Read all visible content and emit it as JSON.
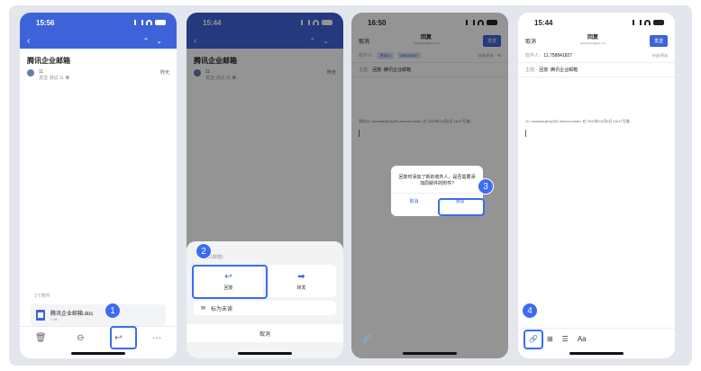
{
  "screens": [
    {
      "time": "15:56",
      "mail": {
        "subject": "腾讯企业邮箱",
        "sender_name": "11",
        "sender_detail": "发送 测试 11 ◉",
        "date": "昨天",
        "attachment_count": "1个附件",
        "attachment_name": "腾讯企业邮箱.doc",
        "attachment_size": "1.9K"
      },
      "toolbar_icons": [
        "delete-icon",
        "forward-circle-icon",
        "reply-icon",
        "more-icon"
      ],
      "step": "1"
    },
    {
      "time": "15:44",
      "mail": {
        "subject": "腾讯企业邮箱",
        "sender_name": "11",
        "sender_detail": "发送 测试 11 ◉",
        "date": "昨天"
      },
      "sheet": {
        "header": "(11邮箱)",
        "reply": "回复",
        "forward": "转发",
        "mark_unread": "标为未读",
        "cancel": "取消"
      },
      "step": "2"
    },
    {
      "time": "16:50",
      "compose": {
        "cancel": "取消",
        "title": "回复",
        "account": "11sadsh123@qq.com",
        "send": "发送",
        "to_label": "收件人:",
        "chip1": "测试11",
        "chip2": "758841827",
        "cc_label": "抄送/密送",
        "subject_label": "主题:",
        "subject_value": "回复: 腾讯企业邮箱",
        "quote": "测试11 <wushan@xiy321.wecom.work> 在 2023年10月6日 16:47写道:"
      },
      "dialog": {
        "message": "回复时添加了新的收件人，是否需要添加原邮件的附件?",
        "cancel": "取消",
        "add": "添加"
      },
      "step": "3"
    },
    {
      "time": "15:44",
      "compose": {
        "cancel": "取消",
        "title": "回复",
        "account": "11sadsh123@qq.com",
        "send": "发送",
        "to_label": "收件人:",
        "to_value": "11,758841827",
        "cc_label": "抄送/密送",
        "subject_label": "主题:",
        "subject_value": "回复: 腾讯企业邮箱",
        "quote": "11 <wushan@xiy321.wecom.work> 在 2023年10月6日 16:47写道:"
      },
      "format_label": "Aa",
      "step": "4"
    }
  ],
  "colors": {
    "accent": "#3e63d9",
    "highlight": "#3a6cf4"
  }
}
